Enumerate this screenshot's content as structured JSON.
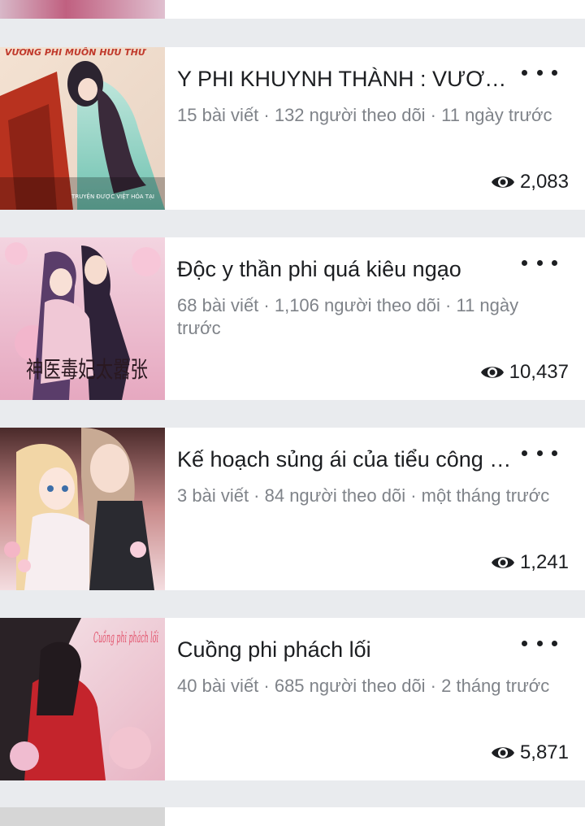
{
  "posts": [
    {
      "title": "Y PHI KHUYNH THÀNH : VƯƠNG PHI MUỐN HƯU THƯ",
      "meta": "15 bài viết · 132 người theo dõi · 11 ngày trước",
      "views": "2,083",
      "cover_text": "VƯƠNG PHI MUỐN HƯU THƯ",
      "cover_subtext": "TRUYỆN ĐƯỢC VIỆT HÓA TẠI"
    },
    {
      "title": "Độc y thần phi quá kiêu ngạo",
      "meta": "68 bài viết · 1,106 người theo dõi · 11 ngày trước",
      "views": "10,437",
      "cover_text": "神医毒妃太嚣张"
    },
    {
      "title": "Kế hoạch sủng ái của tiểu công chúa",
      "meta": "3 bài viết · 84 người theo dõi · một tháng trước",
      "views": "1,241"
    },
    {
      "title": "Cuồng phi phách lối",
      "meta": "40 bài viết · 685 người theo dõi · 2 tháng trước",
      "views": "5,871",
      "cover_text": "Cuồng phi phách lối"
    }
  ],
  "icons": {
    "more": "more-options-icon",
    "views": "eye-icon"
  }
}
